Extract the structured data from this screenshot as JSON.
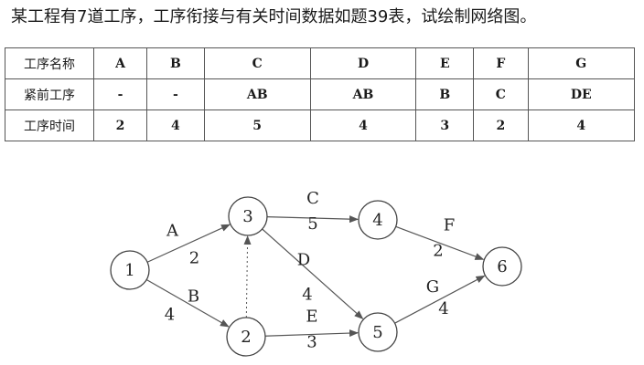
{
  "question": "某工程有7道工序，工序衔接与有关时间数据如题39表，试绘制网络图。",
  "table": {
    "rows": [
      {
        "header": "工序名称",
        "cells": [
          "A",
          "B",
          "C",
          "D",
          "E",
          "F",
          "G"
        ]
      },
      {
        "header": "紧前工序",
        "cells": [
          "-",
          "-",
          "AB",
          "AB",
          "B",
          "C",
          "DE"
        ]
      },
      {
        "header": "工序时间",
        "cells": [
          "2",
          "4",
          "5",
          "4",
          "3",
          "2",
          "4"
        ]
      }
    ]
  },
  "network": {
    "nodes": [
      {
        "id": "1",
        "label": "1"
      },
      {
        "id": "2",
        "label": "2"
      },
      {
        "id": "3",
        "label": "3"
      },
      {
        "id": "4",
        "label": "4"
      },
      {
        "id": "5",
        "label": "5"
      },
      {
        "id": "6",
        "label": "6"
      }
    ],
    "edges": [
      {
        "from": "1",
        "to": "3",
        "name": "A",
        "time": "2",
        "dashed": false
      },
      {
        "from": "1",
        "to": "2",
        "name": "B",
        "time": "4",
        "dashed": false
      },
      {
        "from": "3",
        "to": "4",
        "name": "C",
        "time": "5",
        "dashed": false
      },
      {
        "from": "3",
        "to": "5",
        "name": "D",
        "time": "4",
        "dashed": false
      },
      {
        "from": "2",
        "to": "5",
        "name": "E",
        "time": "3",
        "dashed": false
      },
      {
        "from": "4",
        "to": "6",
        "name": "F",
        "time": "2",
        "dashed": false
      },
      {
        "from": "5",
        "to": "6",
        "name": "G",
        "time": "4",
        "dashed": false
      },
      {
        "from": "2",
        "to": "3",
        "name": "",
        "time": "",
        "dashed": true
      }
    ]
  }
}
